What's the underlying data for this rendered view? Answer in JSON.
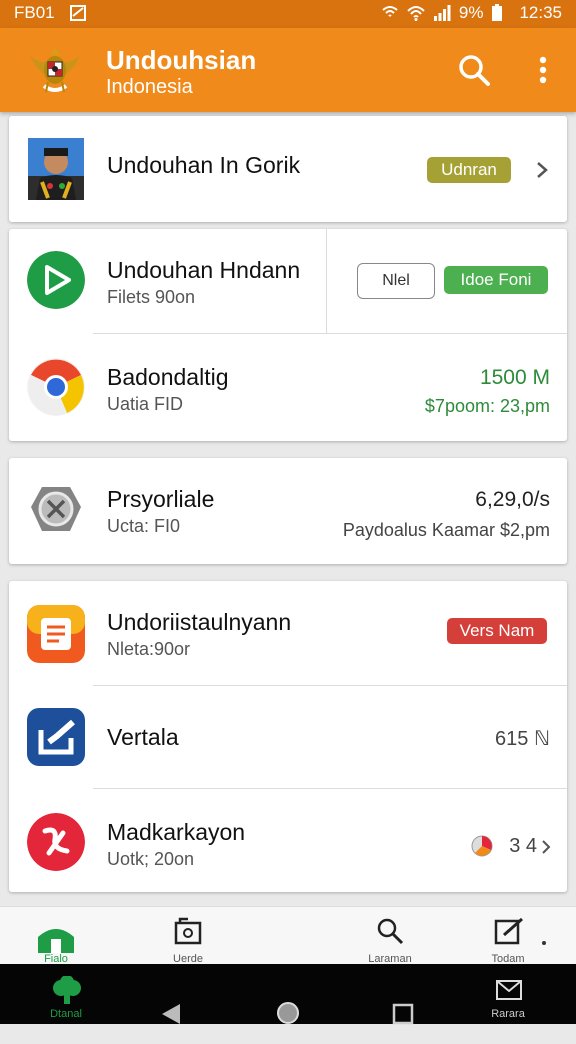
{
  "status_bar": {
    "left_text": "FB01",
    "battery": "9%",
    "time": "12:35"
  },
  "app_bar": {
    "title": "Undouhsian",
    "subtitle": "Indonesia",
    "search_icon": "search-icon",
    "menu_icon": "more-vert-icon"
  },
  "items": [
    {
      "title": "Undouhan In Gorik",
      "pill": "Udnran",
      "pill_color": "#a6a134"
    },
    {
      "title": "Undouhan Hndann",
      "sub": "Filets 90on",
      "outline_button": "Nlel",
      "pill": "Idoe Foni",
      "pill_color": "#4caf50"
    },
    {
      "title": "Badondaltig",
      "sub": "Uatia FID",
      "right_top": "1500 M",
      "right_bottom": "$7poom: 23,pm"
    },
    {
      "title": "Prsyorliale",
      "sub": "Ucta: FI0",
      "right_top": "6,29,0/s",
      "right_bottom": "Paydoalus Kaamar $2,pm"
    },
    {
      "title": "Undoriistaulnyann",
      "sub": "Nleta:90or",
      "pill": "Vers Nam",
      "pill_color": "#d43f3a"
    },
    {
      "title": "Vertala",
      "right_top": "615 ℕ"
    },
    {
      "title": "Madkarkayon",
      "sub": "Uotk; 20on",
      "right_top": "3 4"
    }
  ],
  "bottom_nav": [
    {
      "label": "Fialo",
      "icon": "home-icon"
    },
    {
      "label": "Uerde",
      "icon": "folder-icon"
    },
    {
      "label": "Laraman",
      "icon": "search-icon"
    },
    {
      "label": "Todam",
      "icon": "edit-icon"
    }
  ],
  "system_nav": {
    "left_label": "Dtanal",
    "right_label": "Rarara"
  }
}
